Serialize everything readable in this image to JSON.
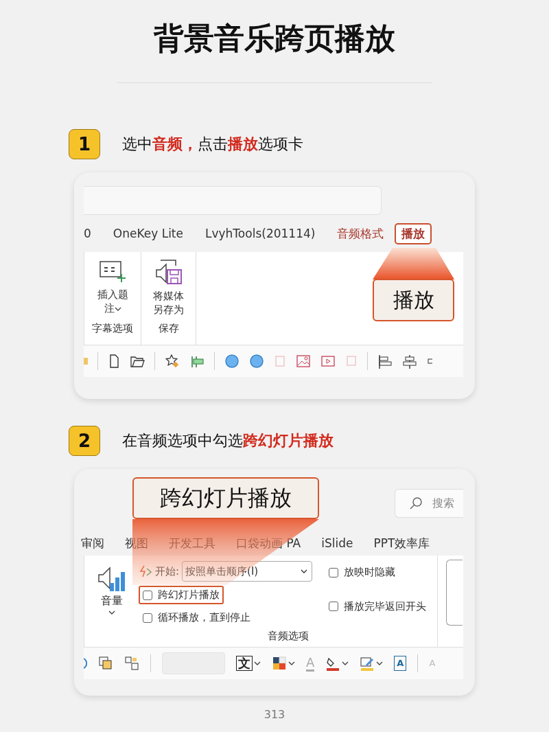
{
  "title": "背景音乐跨页播放",
  "steps": [
    {
      "number": "1",
      "instruction": "选中**音频，**点击**播放**选项卡",
      "screen": {
        "tabs": [
          {
            "label": "0",
            "selected": false,
            "contextual": false
          },
          {
            "label": "OneKey Lite",
            "selected": false,
            "contextual": false
          },
          {
            "label": "LvyhTools(201114)",
            "selected": false,
            "contextual": false
          },
          {
            "label": "音频格式",
            "selected": false,
            "contextual": true
          },
          {
            "label": "播放",
            "selected": true,
            "contextual": true
          }
        ],
        "groups": [
          {
            "label": "字幕选项",
            "button": {
              "kind": "caption",
              "label": "插入题注",
              "dropdown": true
            }
          },
          {
            "label": "保存",
            "button": {
              "kind": "save-media",
              "label": "将媒体另存为",
              "dropdown": false
            }
          }
        ],
        "callout": "播放"
      }
    },
    {
      "number": "2",
      "instruction": "在音频选项中勾选**跨幻灯片播放**",
      "screen": {
        "search": {
          "placeholder": "搜索"
        },
        "tabs": [
          {
            "label": "审阅",
            "selected": false
          },
          {
            "label": "视图",
            "selected": false
          },
          {
            "label": "开发工具",
            "selected": false
          },
          {
            "label": "口袋动画 PA",
            "selected": false
          },
          {
            "label": "iSlide",
            "selected": false
          },
          {
            "label": "PPT效率库",
            "selected": false
          }
        ],
        "volume": {
          "label": "音量"
        },
        "start": {
          "label": "开始:",
          "value": "按照单击顺序(I)"
        },
        "options": [
          {
            "label": "跨幻灯片播放",
            "checked": false,
            "highlighted": true
          },
          {
            "label": "循环播放，直到停止",
            "checked": false,
            "highlighted": false
          },
          {
            "label": "放映时隐藏",
            "checked": false,
            "highlighted": false
          },
          {
            "label": "播放完毕返回开头",
            "checked": false,
            "highlighted": false
          }
        ],
        "group_label": "音频选项",
        "glyphs": {
          "text_direction": "文",
          "font_color": "A",
          "text_box": "A",
          "paste": "A"
        },
        "callout": "跨幻灯片播放"
      }
    }
  ],
  "page_number": "313"
}
